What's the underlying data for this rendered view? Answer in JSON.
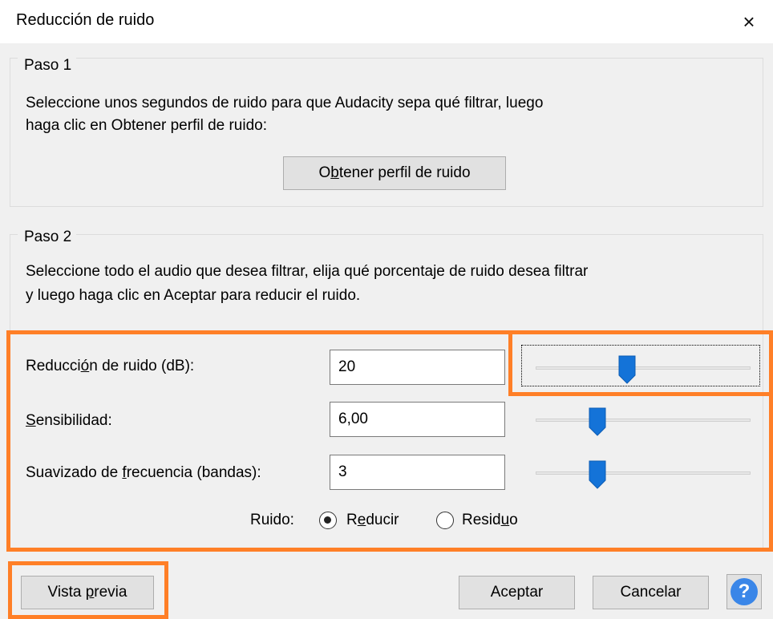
{
  "window": {
    "title": "Reducción de ruido",
    "close_icon": "×"
  },
  "step1": {
    "legend": "Paso 1",
    "line1": "Seleccione unos segundos de ruido para que Audacity sepa qué filtrar, luego",
    "line2": "haga clic en Obtener perfil de ruido:",
    "button": {
      "pre": "O",
      "accel": "b",
      "post": "tener perfil de ruido"
    }
  },
  "step2": {
    "legend": "Paso 2",
    "line1": "Seleccione todo el audio que desea filtrar, elija qué porcentaje de ruido desea filtrar",
    "line2": "y luego haga clic en Aceptar para reducir el ruido."
  },
  "fields": {
    "noise_reduction": {
      "pre": "Reducci",
      "accel": "ó",
      "post": "n de ruido (dB):",
      "value": "20",
      "slider_level": 0.42
    },
    "sensitivity": {
      "pre": "",
      "accel": "S",
      "post": "ensibilidad:",
      "value": "6,00",
      "slider_level": 0.27
    },
    "freq_smoothing": {
      "pre": "Suavizado de ",
      "accel": "f",
      "post": "recuencia (bandas):",
      "value": "3",
      "slider_level": 0.27
    }
  },
  "noise": {
    "label": "Ruido:",
    "reduce": {
      "pre": "R",
      "accel": "e",
      "post": "ducir",
      "selected": true
    },
    "residue": {
      "pre": "Resid",
      "accel": "u",
      "post": "o",
      "selected": false
    }
  },
  "buttons": {
    "preview": {
      "pre": "Vista ",
      "accel": "p",
      "post": "revia"
    },
    "ok": "Aceptar",
    "cancel": "Cancelar",
    "help": "?"
  },
  "colors": {
    "highlight": "#ff7f27",
    "slider_thumb": "#1473d8",
    "help_blue": "#3a86e8"
  }
}
